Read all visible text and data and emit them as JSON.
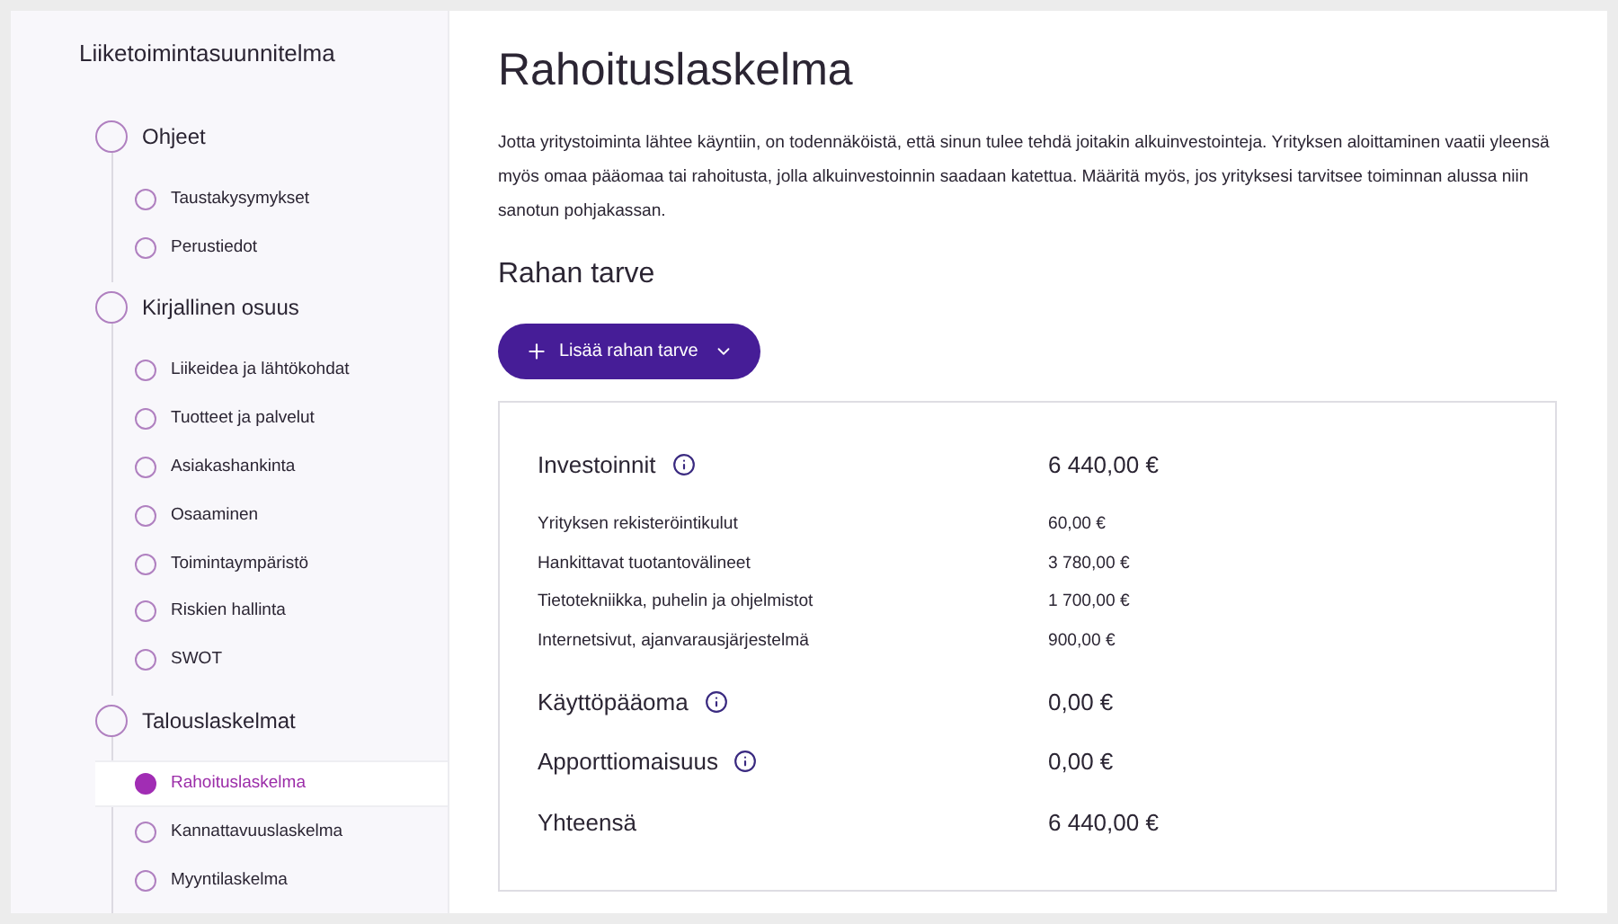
{
  "sidebar": {
    "title": "Liiketoimintasuunnitelma",
    "sections": [
      {
        "label": "Ohjeet",
        "selected": false,
        "children": [
          {
            "label": "Taustakysymykset",
            "selected": false
          },
          {
            "label": "Perustiedot",
            "selected": false
          }
        ]
      },
      {
        "label": "Kirjallinen osuus",
        "selected": false,
        "children": [
          {
            "label": "Liikeidea ja lähtökohdat",
            "selected": false
          },
          {
            "label": "Tuotteet ja palvelut",
            "selected": false
          },
          {
            "label": "Asiakashankinta",
            "selected": false
          },
          {
            "label": "Osaaminen",
            "selected": false
          },
          {
            "label": "Toimintaympäristö",
            "selected": false
          },
          {
            "label": "Riskien hallinta",
            "selected": false
          },
          {
            "label": "SWOT",
            "selected": false
          }
        ]
      },
      {
        "label": "Talouslaskelmat",
        "selected": false,
        "children": [
          {
            "label": "Rahoituslaskelma",
            "selected": true
          },
          {
            "label": "Kannattavuuslaskelma",
            "selected": false
          },
          {
            "label": "Myyntilaskelma",
            "selected": false
          }
        ]
      }
    ]
  },
  "main": {
    "title": "Rahoituslaskelma",
    "intro": "Jotta yritystoiminta lähtee käyntiin, on todennäköistä, että sinun tulee tehdä joitakin alkuinvestointeja. Yrityksen aloittaminen vaatii yleensä myös omaa pääomaa tai rahoitusta, jolla alkuinvestoinnin saadaan katettua. Määritä myös, jos yrityksesi tarvitsee toiminnan alussa niin sanotun pohjakassan.",
    "subtitle": "Rahan tarve",
    "add_button": "Lisää rahan tarve",
    "rows": [
      {
        "kind": "group",
        "label": "Investoinnit",
        "value": "6 440,00 €",
        "info": true
      },
      {
        "kind": "item",
        "label": "Yrityksen rekisteröintikulut",
        "value": "60,00 €"
      },
      {
        "kind": "item",
        "label": "Hankittavat tuotantovälineet",
        "value": "3 780,00 €"
      },
      {
        "kind": "item",
        "label": "Tietotekniikka, puhelin ja ohjelmistot",
        "value": "1 700,00 €"
      },
      {
        "kind": "item",
        "label": "Internetsivut, ajanvarausjärjestelmä",
        "value": "900,00 €"
      },
      {
        "kind": "group",
        "label": "Käyttöpääoma",
        "value": "0,00 €",
        "info": true
      },
      {
        "kind": "group",
        "label": "Apporttiomaisuus",
        "value": "0,00 €",
        "info": true
      },
      {
        "kind": "group",
        "label": "Yhteensä",
        "value": "6 440,00 €",
        "info": false
      }
    ]
  }
}
